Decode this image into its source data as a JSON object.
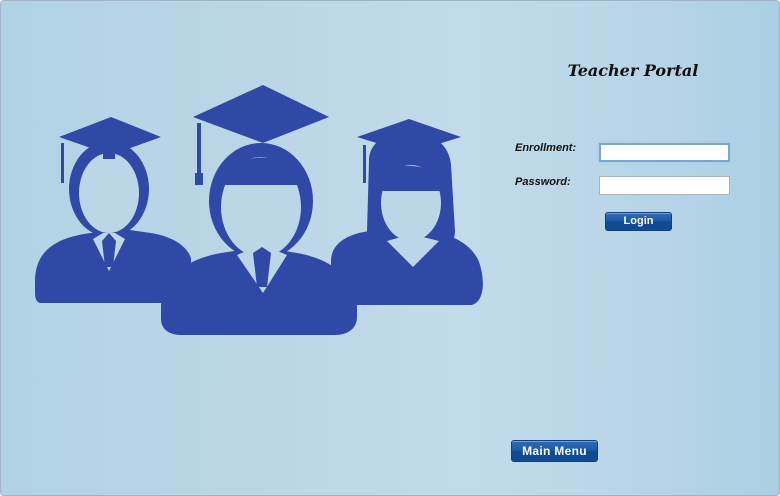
{
  "window": {
    "background": "#bbd6e6"
  },
  "illustration": {
    "icon": "graduates-icon",
    "color": "#3149a6"
  },
  "portal": {
    "title": "Teacher Portal"
  },
  "form": {
    "enrollment_label": "Enrollment:",
    "enrollment_value": "",
    "password_label": "Password:",
    "password_value": "",
    "login_label": "Login"
  },
  "footer": {
    "main_menu_label": "Main Menu"
  },
  "colors": {
    "button": "#1a5aa6",
    "button_text": "#ffffff",
    "focus_border": "#7ba6cf"
  }
}
